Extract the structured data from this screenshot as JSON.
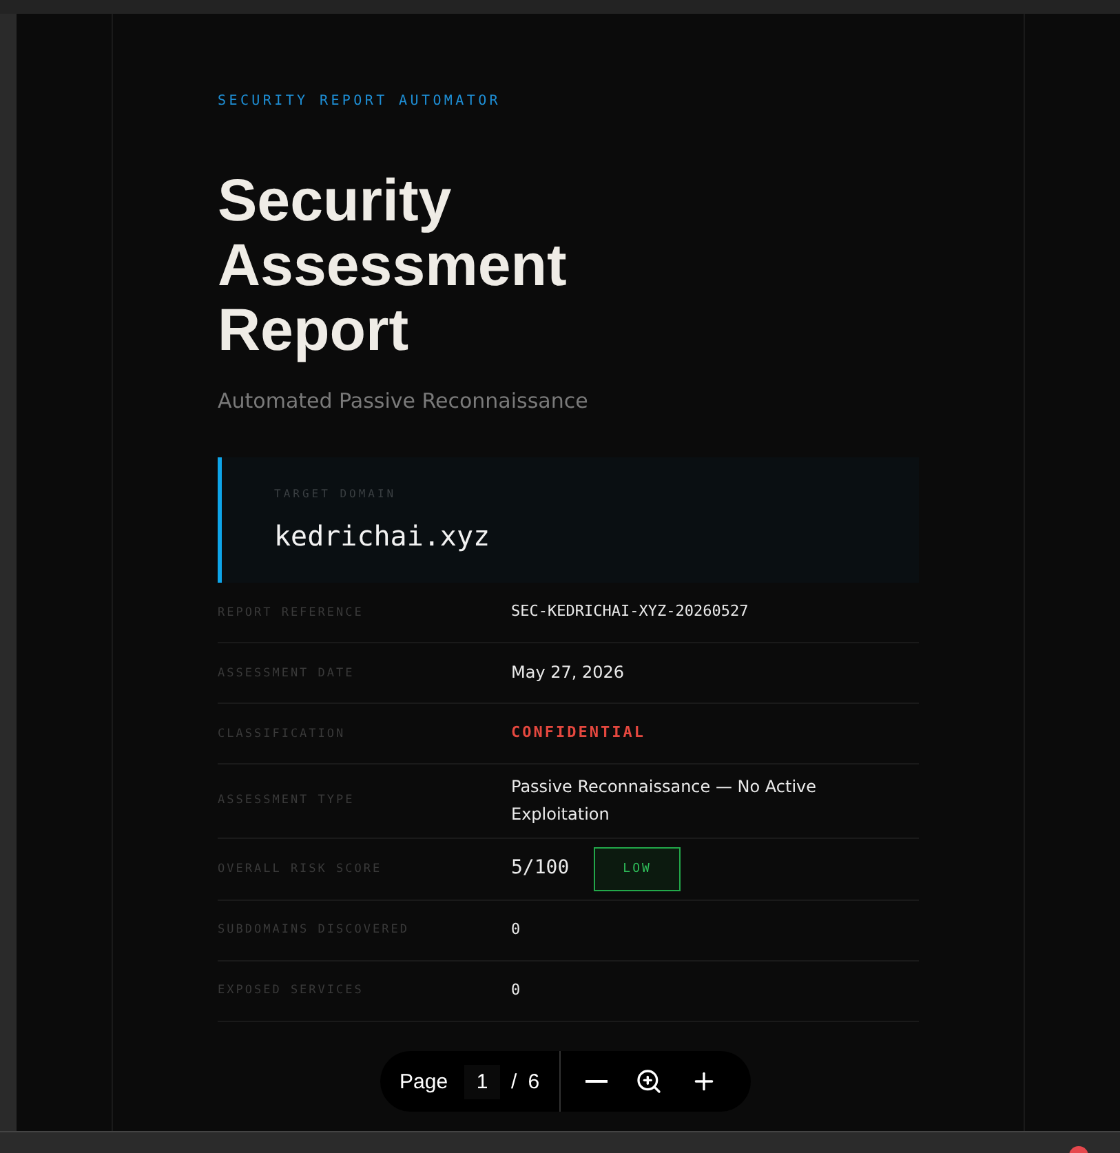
{
  "header": {
    "eyebrow": "SECURITY REPORT AUTOMATOR",
    "title": "Security Assessment Report",
    "subtitle": "Automated Passive Reconnaissance"
  },
  "target": {
    "label": "TARGET DOMAIN",
    "domain": "kedrichai.xyz"
  },
  "rows": [
    {
      "label": "REPORT REFERENCE",
      "value": "SEC-KEDRICHAI-XYZ-20260527",
      "kind": "mono"
    },
    {
      "label": "ASSESSMENT DATE",
      "value": "May 27, 2026",
      "kind": "text"
    },
    {
      "label": "CLASSIFICATION",
      "value": "CONFIDENTIAL",
      "kind": "alert"
    },
    {
      "label": "ASSESSMENT TYPE",
      "value": "Passive Reconnaissance — No Active Exploitation",
      "kind": "text"
    },
    {
      "label": "OVERALL RISK SCORE",
      "value": "5/100",
      "kind": "score",
      "badge": "LOW"
    },
    {
      "label": "SUBDOMAINS DISCOVERED",
      "value": "0",
      "kind": "mono"
    },
    {
      "label": "EXPOSED SERVICES",
      "value": "0",
      "kind": "mono"
    }
  ],
  "pager": {
    "label": "Page",
    "current": "1",
    "separator": "/",
    "total": "6"
  }
}
